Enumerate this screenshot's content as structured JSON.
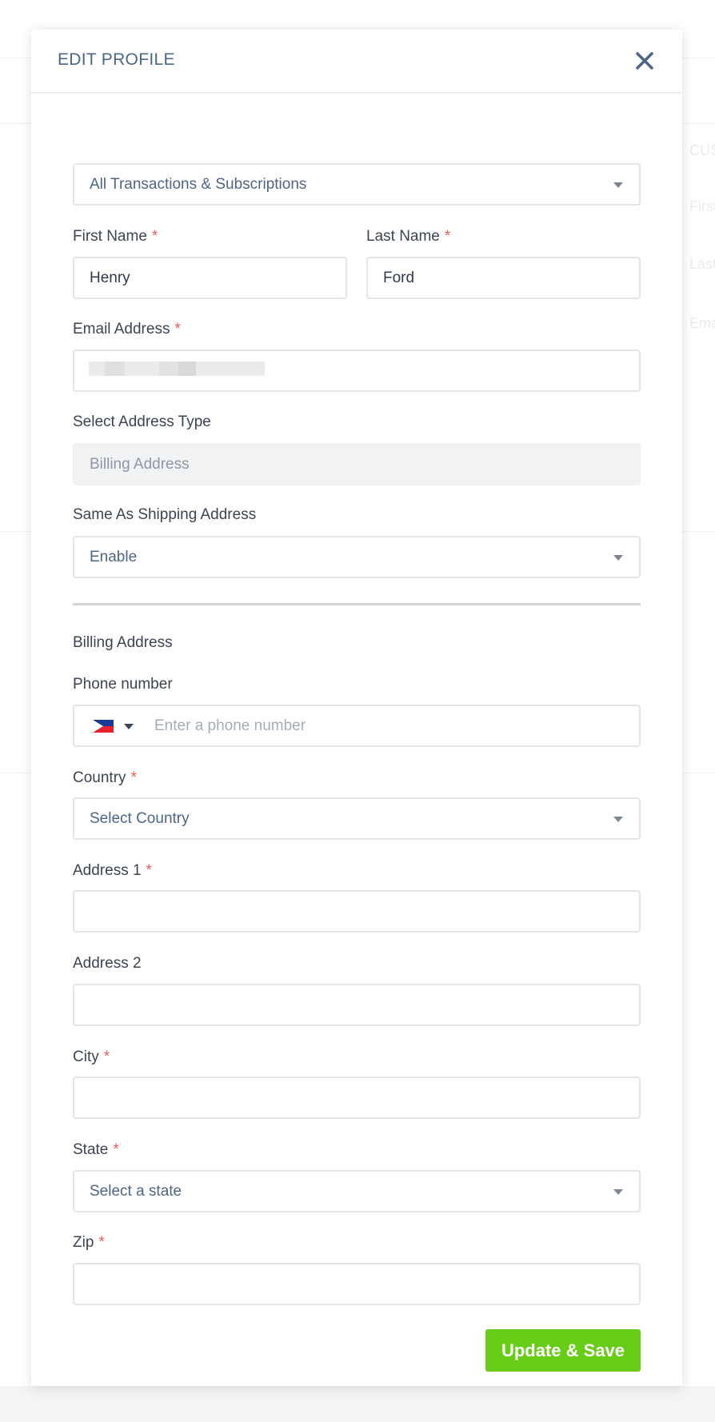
{
  "background": {
    "texts": [
      "CUS",
      "First",
      "Last",
      "Ema"
    ]
  },
  "modal": {
    "title": "EDIT PROFILE",
    "close_icon": "close-icon"
  },
  "form": {
    "subscription_select": {
      "value": "All Transactions & Subscriptions"
    },
    "first_name": {
      "label": "First Name",
      "required": "*",
      "value": "Henry"
    },
    "last_name": {
      "label": "Last Name",
      "required": "*",
      "value": "Ford"
    },
    "email": {
      "label": "Email Address",
      "required": "*",
      "value": ""
    },
    "address_type": {
      "label": "Select Address Type",
      "value": "Billing Address"
    },
    "same_as_shipping": {
      "label": "Same As Shipping Address",
      "value": "Enable"
    },
    "section_title": "Billing Address",
    "phone": {
      "label": "Phone number",
      "placeholder": "Enter a phone number",
      "flag": "philippines-flag-icon"
    },
    "country": {
      "label": "Country",
      "required": "*",
      "placeholder": "Select Country"
    },
    "address1": {
      "label": "Address 1",
      "required": "*",
      "value": ""
    },
    "address2": {
      "label": "Address 2",
      "value": ""
    },
    "city": {
      "label": "City",
      "required": "*",
      "value": ""
    },
    "state": {
      "label": "State",
      "required": "*",
      "placeholder": "Select a state"
    },
    "zip": {
      "label": "Zip",
      "required": "*",
      "value": ""
    },
    "save_button": "Update & Save"
  },
  "colors": {
    "accent_green": "#67cc16",
    "required_red": "#e85c5c",
    "title_blue": "#4d6685"
  }
}
